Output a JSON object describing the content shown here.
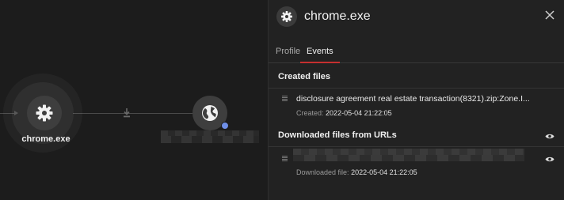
{
  "graph": {
    "nodes": [
      {
        "label": "chrome.exe",
        "icon": "gear-icon"
      },
      {
        "label": "",
        "icon": "globe-icon"
      }
    ],
    "edge_icon": "download-icon"
  },
  "panel": {
    "title": "chrome.exe",
    "icon": "gear-icon",
    "tabs": [
      {
        "label": "Profile",
        "active": false
      },
      {
        "label": "Events",
        "active": true
      }
    ],
    "sections": [
      {
        "title": "Created files",
        "items": [
          {
            "name": "disclosure agreement real estate transaction(8321).zip:Zone.I...",
            "sub_label": "Created:",
            "sub_value": "2022-05-04 21:22:05"
          }
        ]
      },
      {
        "title": "Downloaded files from URLs",
        "items": [
          {
            "name": "",
            "sub_label": "Downloaded file:",
            "sub_value": "2022-05-04 21:22:05"
          }
        ]
      }
    ]
  },
  "colors": {
    "accent": "#c62f2f",
    "badge": "#6f8fe8"
  }
}
